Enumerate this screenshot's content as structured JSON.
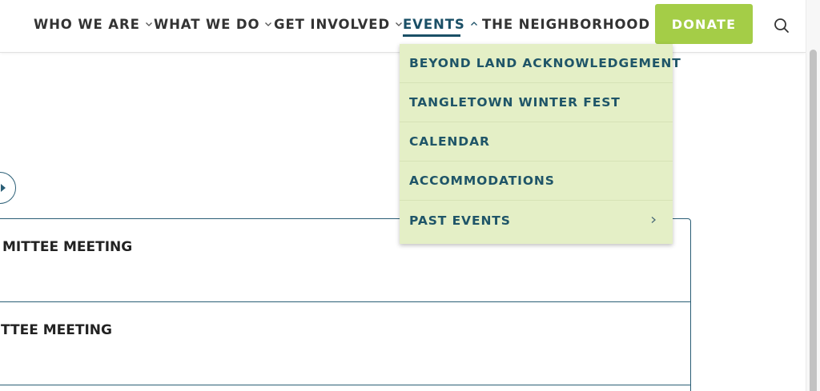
{
  "nav": {
    "items": [
      {
        "label": "WHO WE ARE"
      },
      {
        "label": "WHAT WE DO"
      },
      {
        "label": "GET INVOLVED"
      },
      {
        "label": "EVENTS"
      },
      {
        "label": "THE NEIGHBORHOOD"
      }
    ],
    "donate_label": "DONATE",
    "active_item": "EVENTS"
  },
  "dropdown": {
    "items": [
      {
        "label": "BEYOND LAND ACKNOWLEDGEMENT"
      },
      {
        "label": "TANGLETOWN WINTER FEST"
      },
      {
        "label": "CALENDAR"
      },
      {
        "label": "ACCOMMODATIONS"
      },
      {
        "label": "PAST EVENTS"
      }
    ]
  },
  "events": {
    "rows": [
      {
        "title": "MITTEE MEETING"
      },
      {
        "title": "TTEE MEETING"
      }
    ]
  },
  "colors": {
    "accent": "#1a4f66",
    "donate": "#a4cd47",
    "dropdown_bg": "#e4efc6"
  }
}
